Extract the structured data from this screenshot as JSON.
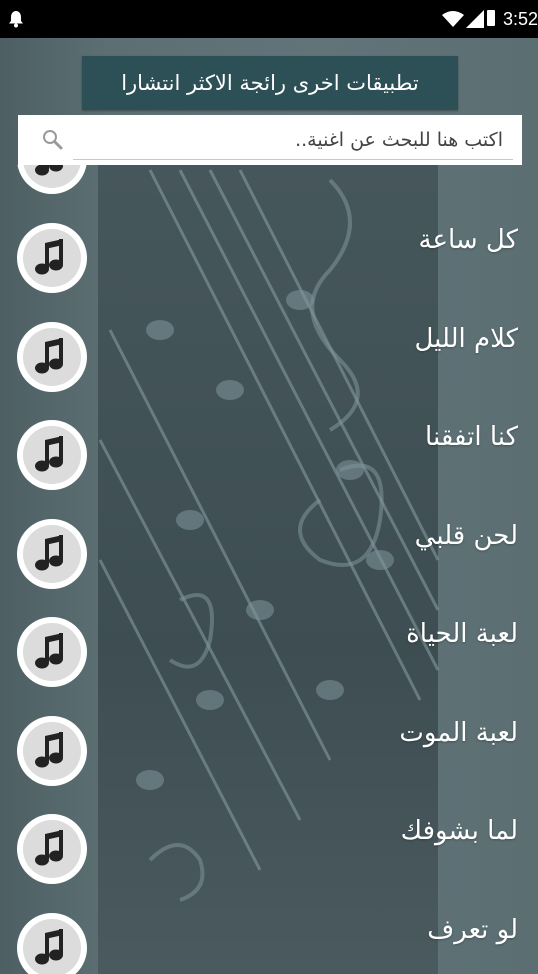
{
  "status_bar": {
    "time": "3:52"
  },
  "banner": {
    "label": "تطبيقات اخرى رائجة الاكثر انتشارا"
  },
  "search": {
    "placeholder": "اكتب هنا للبحث عن اغنية.."
  },
  "songs": [
    {
      "title": "كل ساعة"
    },
    {
      "title": "كلام الليل"
    },
    {
      "title": "كنا اتفقنا"
    },
    {
      "title": "لحن قلبي"
    },
    {
      "title": "لعبة الحياة"
    },
    {
      "title": "لعبة الموت"
    },
    {
      "title": "لما بشوفك"
    },
    {
      "title": "لو تعرف"
    }
  ],
  "icons": {
    "song": "music-note-icon",
    "search": "search-icon",
    "notification": "bell-icon"
  },
  "colors": {
    "banner": "#2d5057",
    "background": "#5a6d72",
    "status_bar": "#000000"
  }
}
